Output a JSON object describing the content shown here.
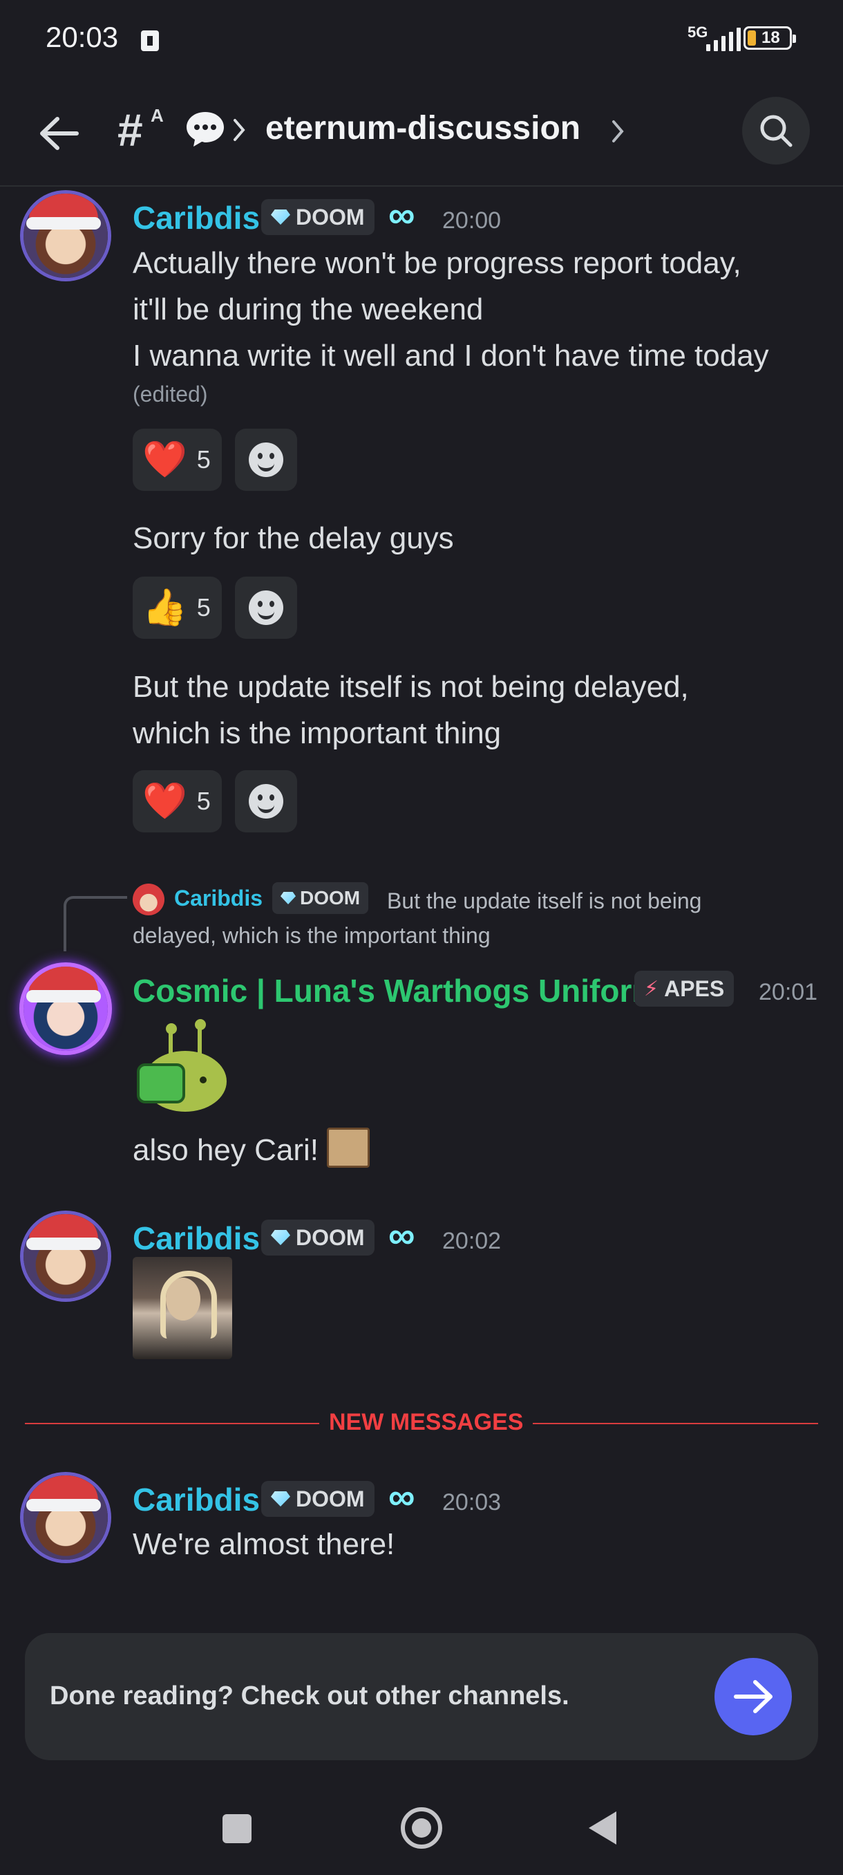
{
  "status": {
    "time": "20:03",
    "network": "5G",
    "battery": "18"
  },
  "header": {
    "channel_name": "eternum-discussion"
  },
  "messages": [
    {
      "author": "Caribdis",
      "tag": "DOOM",
      "time": "20:00",
      "lines": [
        "Actually there won't be progress report today,",
        "it'll be during the weekend",
        "I wanna write it well and I don't have time today"
      ],
      "edited": "(edited)",
      "reaction": {
        "emoji": "❤️",
        "count": "5"
      }
    },
    {
      "text": "Sorry for the delay guys",
      "reaction": {
        "emoji": "👍",
        "count": "5"
      }
    },
    {
      "lines": [
        "But the update itself is not being delayed,",
        "which is the important thing"
      ],
      "reaction": {
        "emoji": "❤️",
        "count": "5"
      }
    }
  ],
  "reply": {
    "author": "Caribdis",
    "tag": "DOOM",
    "text": "But the update itself is not being delayed, which is the important thing"
  },
  "cosmic": {
    "author": "Cosmic | Luna's Warthogs Uniform",
    "tag": "APES",
    "time": "20:01",
    "text": "also hey Cari!"
  },
  "gif_message": {
    "author": "Caribdis",
    "tag": "DOOM",
    "time": "20:02"
  },
  "divider": {
    "label": "NEW MESSAGES"
  },
  "last_message": {
    "author": "Caribdis",
    "tag": "DOOM",
    "time": "20:03",
    "text": "We're almost there!"
  },
  "done_bar": {
    "text": "Done reading? Check out other channels."
  },
  "colors": {
    "background": "#1c1c22",
    "username_cyan": "#34c3e6",
    "username_green": "#2dc770",
    "accent": "#5865f2",
    "new_messages": "#f23f42"
  }
}
